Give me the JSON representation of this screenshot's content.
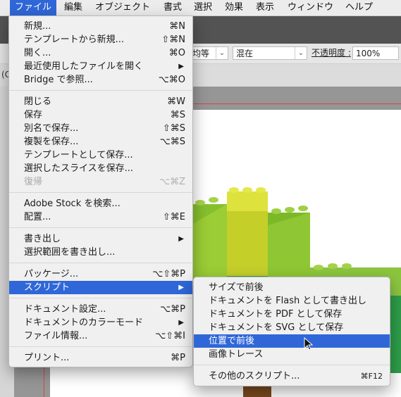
{
  "menubar": {
    "items": [
      "ファイル",
      "編集",
      "オブジェクト",
      "書式",
      "選択",
      "効果",
      "表示",
      "ウィンドウ",
      "ヘルプ"
    ]
  },
  "controlbar": {
    "align_value": "均等",
    "blend_mode": "混在",
    "opacity_label": "不透明度 :",
    "opacity_value": "100%"
  },
  "tabbar": {
    "partial_tab": "(C"
  },
  "file_menu": {
    "items": [
      {
        "label": "新規...",
        "shortcut": "⌘N"
      },
      {
        "label": "テンプレートから新規...",
        "shortcut": "⇧⌘N"
      },
      {
        "label": "開く...",
        "shortcut": "⌘O"
      },
      {
        "label": "最近使用したファイルを開く",
        "shortcut": "▶"
      },
      {
        "label": "Bridge で参照...",
        "shortcut": "⌥⌘O"
      },
      {
        "label": "閉じる",
        "shortcut": "⌘W"
      },
      {
        "label": "保存",
        "shortcut": "⌘S"
      },
      {
        "label": "別名で保存...",
        "shortcut": "⇧⌘S"
      },
      {
        "label": "複製を保存...",
        "shortcut": "⌥⌘S"
      },
      {
        "label": "テンプレートとして保存...",
        "shortcut": ""
      },
      {
        "label": "選択したスライスを保存...",
        "shortcut": ""
      },
      {
        "label": "復帰",
        "shortcut": "⌥⌘Z"
      },
      {
        "label": "Adobe Stock を検索...",
        "shortcut": ""
      },
      {
        "label": "配置...",
        "shortcut": "⇧⌘E"
      },
      {
        "label": "書き出し",
        "shortcut": "▶"
      },
      {
        "label": "選択範囲を書き出し...",
        "shortcut": ""
      },
      {
        "label": "パッケージ...",
        "shortcut": "⌥⇧⌘P"
      },
      {
        "label": "スクリプト",
        "shortcut": "▶"
      },
      {
        "label": "ドキュメント設定...",
        "shortcut": "⌥⌘P"
      },
      {
        "label": "ドキュメントのカラーモード",
        "shortcut": "▶"
      },
      {
        "label": "ファイル情報...",
        "shortcut": "⌥⇧⌘I"
      },
      {
        "label": "プリント...",
        "shortcut": "⌘P"
      }
    ]
  },
  "script_menu": {
    "items": [
      {
        "label": "サイズで前後",
        "shortcut": ""
      },
      {
        "label": "ドキュメントを Flash として書き出し",
        "shortcut": ""
      },
      {
        "label": "ドキュメントを PDF として保存",
        "shortcut": ""
      },
      {
        "label": "ドキュメントを SVG として保存",
        "shortcut": ""
      },
      {
        "label": "位置で前後",
        "shortcut": ""
      },
      {
        "label": "画像トレース",
        "shortcut": ""
      },
      {
        "label": "その他のスクリプト...",
        "shortcut": "⌘F12"
      }
    ]
  },
  "colors": {
    "highlight": "#2f67d8",
    "menu_bg": "#f0f0f0",
    "lego_light_green": "#8cc63f",
    "lego_yellow_green": "#c8d62b",
    "lego_dark_green": "#2e9e4a"
  }
}
